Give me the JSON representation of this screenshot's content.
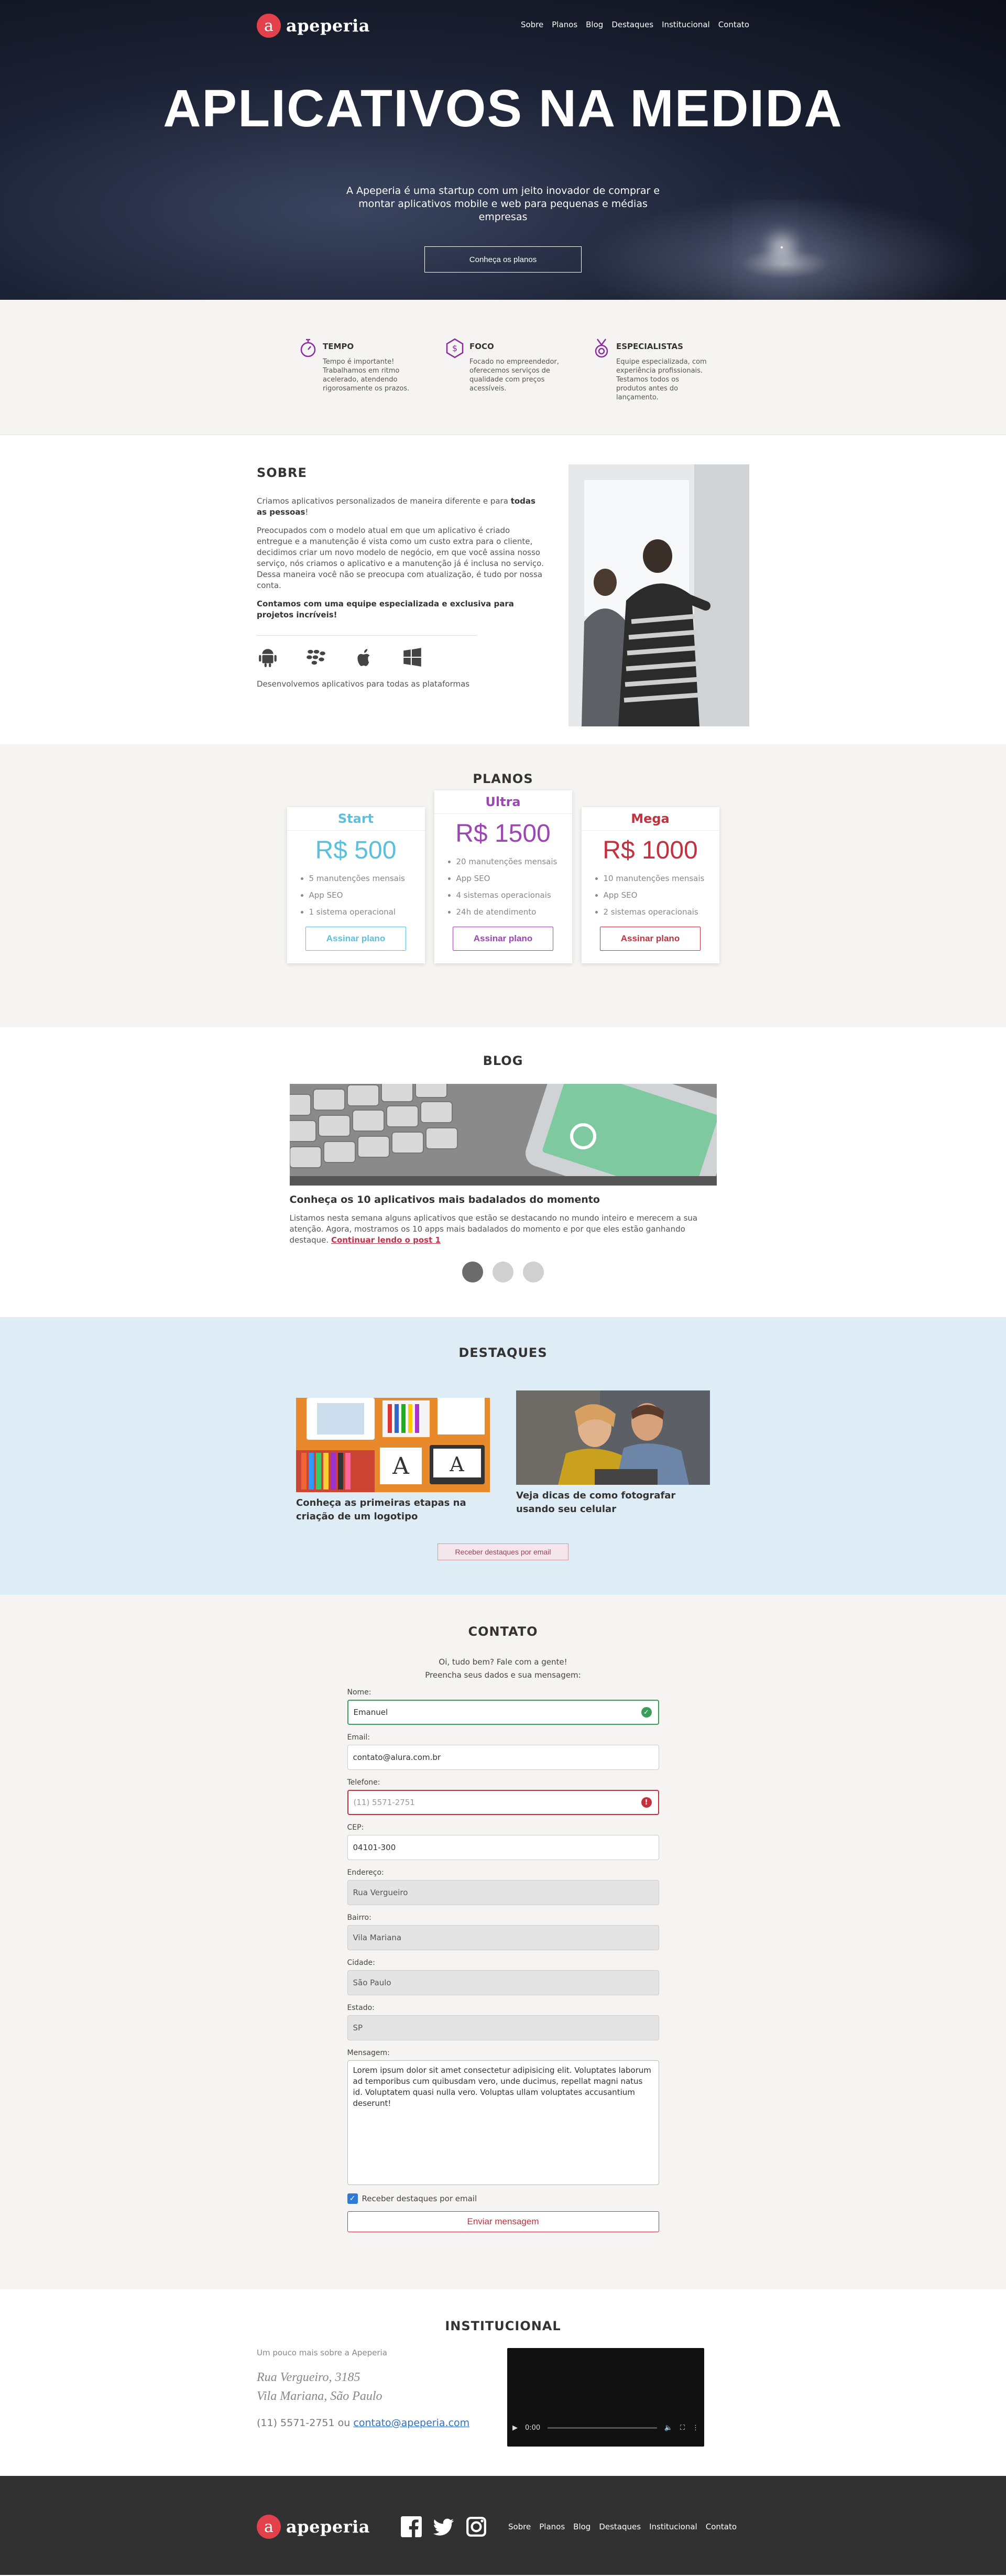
{
  "brand": {
    "name": "apeperia",
    "mark": "a"
  },
  "nav": {
    "items": [
      "Sobre",
      "Planos",
      "Blog",
      "Destaques",
      "Institucional",
      "Contato"
    ]
  },
  "hero": {
    "title": "APLICATIVOS NA MEDIDA",
    "lead": "A Apeperia é uma startup com um jeito inovador de comprar e montar aplicativos mobile e web para pequenas e médias empresas",
    "cta": "Conheça os planos"
  },
  "features": [
    {
      "icon": "stopwatch-icon",
      "title": "TEMPO",
      "text": "Tempo é importante! Trabalhamos em ritmo acelerado, atendendo rigorosamente os prazos."
    },
    {
      "icon": "dollar-icon",
      "title": "FOCO",
      "text": "Focado no empreendedor, oferecemos serviços de qualidade com preços acessíveis."
    },
    {
      "icon": "medal-icon",
      "title": "ESPECIALISTAS",
      "text": "Equipe especializada, com experiência profissionais. Testamos todos os produtos antes do lançamento."
    }
  ],
  "sobre": {
    "title": "SOBRE",
    "p1_start": "Criamos aplicativos personalizados de maneira diferente e para ",
    "p1_bold": "todas as pessoas",
    "p1_end": "!",
    "p2": "Preocupados com o modelo atual em que um aplicativo é criado entregue e a manutenção é vista como um custo extra para o cliente, decidimos criar um novo modelo de negócio, em que você assina nosso serviço, nós criamos o aplicativo e a manutenção já é inclusa no serviço. Dessa maneira você não se preocupa com atualização, é tudo por nossa conta.",
    "p3": "Contamos com uma equipe especializada e exclusiva para projetos incríveis!",
    "platforms_caption": "Desenvolvemos aplicativos para todas as plataformas"
  },
  "planos": {
    "title": "PLANOS",
    "plans": [
      {
        "name": "Start",
        "price": "R$ 500",
        "color": "#5bc0de",
        "items": [
          "5 manutenções mensais",
          "App SEO",
          "1 sistema operacional"
        ],
        "button": "Assinar plano"
      },
      {
        "name": "Ultra",
        "price": "R$ 1500",
        "color": "#9b46b3",
        "items": [
          "20 manutenções mensais",
          "App SEO",
          "4 sistemas operacionais",
          "24h de atendimento"
        ],
        "button": "Assinar plano"
      },
      {
        "name": "Mega",
        "price": "R$ 1000",
        "color": "#c5303f",
        "items": [
          "10 manutenções mensais",
          "App SEO",
          "2 sistemas operacionais"
        ],
        "button": "Assinar plano"
      }
    ]
  },
  "blog": {
    "title": "BLOG",
    "post_title": "Conheça os 10 aplicativos mais badalados do momento",
    "post_text": "Listamos nesta semana alguns aplicativos que estão se destacando no mundo inteiro e merecem a sua atenção. Agora, mostramos os 10 apps mais badalados do momento e por que eles estão ganhando destaque. ",
    "read_more": "Continuar lendo o post 1",
    "slides": 3,
    "active_slide": 1
  },
  "destaques": {
    "title": "DESTAQUES",
    "items": [
      "Conheça as primeiras etapas na criação de um logotipo",
      "Veja dicas de como fotografar usando seu celular"
    ],
    "button": "Receber destaques por email"
  },
  "contato": {
    "title": "CONTATO",
    "intro1": "Oi, tudo bem? Fale com a gente!",
    "intro2": "Preencha seus dados e sua mensagem:",
    "fields": {
      "nome": {
        "label": "Nome:",
        "value": "Emanuel"
      },
      "email": {
        "label": "Email:",
        "value": "contato@alura.com.br"
      },
      "telefone": {
        "label": "Telefone:",
        "placeholder": "(11) 5571-2751"
      },
      "cep": {
        "label": "CEP:",
        "value": "04101-300"
      },
      "endereco": {
        "label": "Endereço:",
        "value": "Rua Vergueiro"
      },
      "bairro": {
        "label": "Bairro:",
        "value": "Vila Mariana"
      },
      "cidade": {
        "label": "Cidade:",
        "value": "São Paulo"
      },
      "estado": {
        "label": "Estado:",
        "value": "SP"
      },
      "mensagem": {
        "label": "Mensagem:",
        "value": "Lorem ipsum dolor sit amet consectetur adipisicing elit. Voluptates laborum ad temporibus cum quibusdam vero, unde ducimus, repellat magni natus id. Voluptatem quasi nulla vero. Voluptas ullam voluptates accusantium deserunt!"
      }
    },
    "checkbox": "Receber destaques por email",
    "submit": "Enviar mensagem"
  },
  "institucional": {
    "title": "INSTITUCIONAL",
    "subtitle": "Um pouco mais sobre a Apeperia",
    "address1": "Rua Vergueiro, 3185",
    "address2": "Vila Mariana, São Paulo",
    "phone": "(11) 5571-2751",
    "or": "ou",
    "email": "contato@apeperia.com",
    "video_time": "0:00"
  },
  "colors": {
    "brand": "#e2414b",
    "accent": "#8b2ca3",
    "footer": "#313131"
  }
}
